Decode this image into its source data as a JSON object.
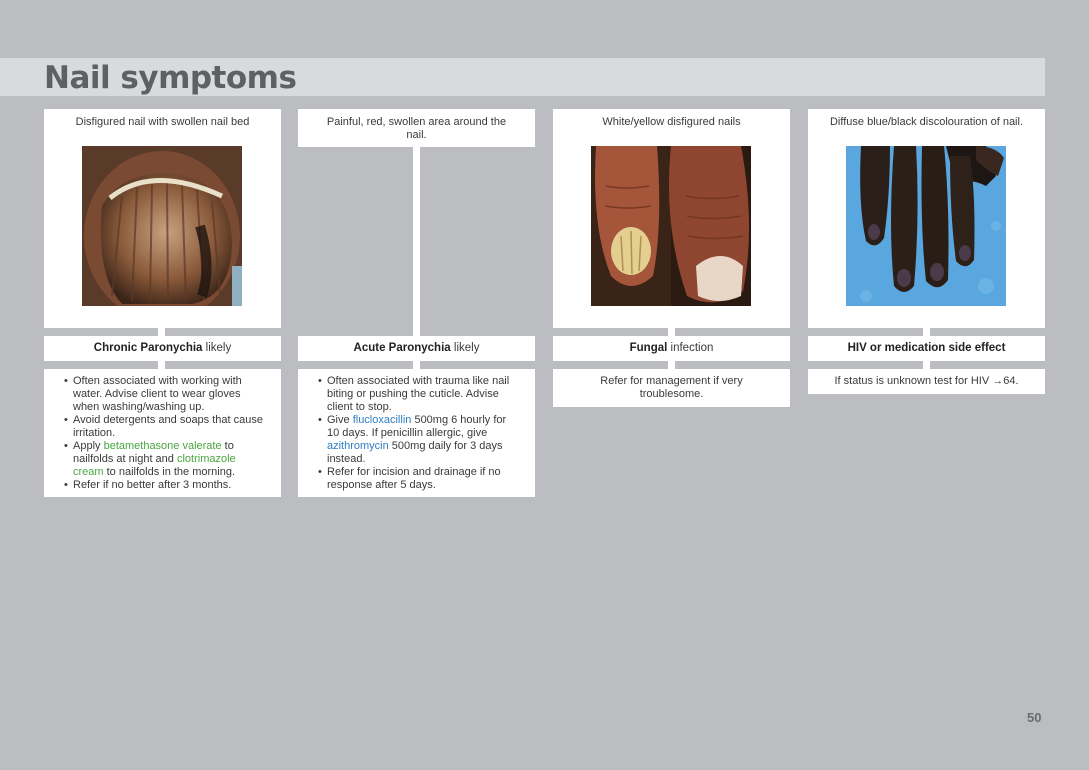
{
  "page": {
    "title": "Nail symptoms",
    "page_number": "50"
  },
  "columns": [
    {
      "symptom": "Disfigured nail with swollen nail bed",
      "has_photo": true,
      "photo_icon": "chronic-paronychia-nail-photo",
      "diagnosis_bold": "Chronic Paronychia",
      "diagnosis_rest": " likely",
      "bullets": [
        {
          "parts": [
            "Often associated with working with water. Advise client to wear gloves when washing/washing up."
          ]
        },
        {
          "parts": [
            "Avoid detergents and soaps that cause irritation."
          ]
        },
        {
          "pre": "Apply ",
          "drug1": "betamethasone valerate",
          "mid": " to nailfolds at night and ",
          "drug2": "clotrimazole cream",
          "post": " to nailfolds in the morning."
        },
        {
          "parts": [
            "Refer if no better after 3 months."
          ]
        }
      ]
    },
    {
      "symptom": "Painful, red, swollen area around the nail.",
      "has_photo": false,
      "diagnosis_bold": "Acute Paronychia",
      "diagnosis_rest": " likely",
      "bullets": [
        {
          "parts": [
            "Often associated with trauma like nail biting or pushing the cuticle. Advise client to stop."
          ]
        },
        {
          "pre": "Give ",
          "drug1": "flucloxacillin",
          "mid": " 500mg 6 hourly for 10 days. If penicillin allergic, give ",
          "drug2": "azithromycin",
          "post": " 500mg daily for 3 days instead."
        },
        {
          "parts": [
            "Refer for incision and drainage if no response after 5 days."
          ]
        }
      ]
    },
    {
      "symptom": "White/yellow disfigured nails",
      "has_photo": true,
      "photo_icon": "fungal-nail-photo",
      "diagnosis_bold": "Fungal",
      "diagnosis_rest": " infection",
      "note": "Refer for management if very troublesome."
    },
    {
      "symptom": "Diffuse blue/black discolouration of nail.",
      "has_photo": true,
      "photo_icon": "discoloured-nails-hand-photo",
      "diagnosis_bold": "HIV or medication side effect",
      "diagnosis_rest": "",
      "note": "If status is unknown test for HIV →64."
    }
  ],
  "colors": {
    "background": "#bcbdc1",
    "title_band": "#d9dadc",
    "drug_green": "#4aa640",
    "drug_blue": "#2f7ec2"
  }
}
